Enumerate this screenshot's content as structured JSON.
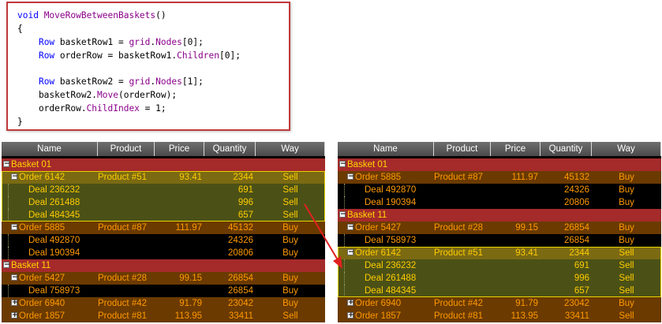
{
  "code": {
    "lines": [
      [
        {
          "t": "void ",
          "c": "kw"
        },
        {
          "t": "MoveRowBetweenBaskets",
          "c": "mt"
        },
        {
          "t": "()",
          "c": ""
        }
      ],
      [
        {
          "t": "{",
          "c": ""
        }
      ],
      [
        {
          "t": "    ",
          "c": ""
        },
        {
          "t": "Row",
          "c": "kw"
        },
        {
          "t": " basketRow1 = ",
          "c": ""
        },
        {
          "t": "grid",
          "c": "mt"
        },
        {
          "t": ".",
          "c": ""
        },
        {
          "t": "Nodes",
          "c": "mt"
        },
        {
          "t": "[0];",
          "c": ""
        }
      ],
      [
        {
          "t": "    ",
          "c": ""
        },
        {
          "t": "Row",
          "c": "kw"
        },
        {
          "t": " orderRow = basketRow1.",
          "c": ""
        },
        {
          "t": "Children",
          "c": "mt"
        },
        {
          "t": "[0];",
          "c": ""
        }
      ],
      [
        {
          "t": "",
          "c": ""
        }
      ],
      [
        {
          "t": "    ",
          "c": ""
        },
        {
          "t": "Row",
          "c": "kw"
        },
        {
          "t": " basketRow2 = ",
          "c": ""
        },
        {
          "t": "grid",
          "c": "mt"
        },
        {
          "t": ".",
          "c": ""
        },
        {
          "t": "Nodes",
          "c": "mt"
        },
        {
          "t": "[1];",
          "c": ""
        }
      ],
      [
        {
          "t": "    basketRow2.",
          "c": ""
        },
        {
          "t": "Move",
          "c": "mt"
        },
        {
          "t": "(orderRow);",
          "c": ""
        }
      ],
      [
        {
          "t": "    orderRow.",
          "c": ""
        },
        {
          "t": "ChildIndex",
          "c": "mt"
        },
        {
          "t": " = 1;",
          "c": ""
        }
      ],
      [
        {
          "t": "}",
          "c": ""
        }
      ]
    ]
  },
  "columns": [
    "Name",
    "Product",
    "Price",
    "Quantity",
    "Way"
  ],
  "grid_left": [
    {
      "kind": "basket",
      "name": "Basket 01",
      "exp": "minus"
    },
    {
      "kind": "order",
      "sel": true,
      "name": "Order 6142",
      "product": "Product #51",
      "price": "93.41",
      "qty": "2344",
      "way": "Sell",
      "exp": "minus"
    },
    {
      "kind": "deal",
      "sel": true,
      "name": "Deal 236232",
      "qty": "691",
      "way": "Sell"
    },
    {
      "kind": "deal",
      "sel": true,
      "name": "Deal 261488",
      "qty": "996",
      "way": "Sell"
    },
    {
      "kind": "deal",
      "sel": true,
      "name": "Deal 484345",
      "qty": "657",
      "way": "Sell"
    },
    {
      "kind": "order",
      "name": "Order 5885",
      "product": "Product #87",
      "price": "111.97",
      "qty": "45132",
      "way": "Buy",
      "exp": "minus"
    },
    {
      "kind": "deal",
      "name": "Deal 492870",
      "qty": "24326",
      "way": "Buy"
    },
    {
      "kind": "deal",
      "name": "Deal 190394",
      "qty": "20806",
      "way": "Buy"
    },
    {
      "kind": "basket",
      "name": "Basket 11",
      "exp": "minus"
    },
    {
      "kind": "order",
      "name": "Order 5427",
      "product": "Product #28",
      "price": "99.15",
      "qty": "26854",
      "way": "Buy",
      "exp": "minus"
    },
    {
      "kind": "deal",
      "name": "Deal 758973",
      "qty": "26854",
      "way": "Buy"
    },
    {
      "kind": "order",
      "name": "Order 6940",
      "product": "Product #42",
      "price": "91.79",
      "qty": "23042",
      "way": "Buy",
      "exp": "plus"
    },
    {
      "kind": "order",
      "name": "Order 1857",
      "product": "Product #81",
      "price": "113.95",
      "qty": "33411",
      "way": "Sell",
      "exp": "plus"
    }
  ],
  "grid_right": [
    {
      "kind": "basket",
      "name": "Basket 01",
      "exp": "minus"
    },
    {
      "kind": "order",
      "name": "Order 5885",
      "product": "Product #87",
      "price": "111.97",
      "qty": "45132",
      "way": "Buy",
      "exp": "minus"
    },
    {
      "kind": "deal",
      "name": "Deal 492870",
      "qty": "24326",
      "way": "Buy"
    },
    {
      "kind": "deal",
      "name": "Deal 190394",
      "qty": "20806",
      "way": "Buy"
    },
    {
      "kind": "basket",
      "name": "Basket 11",
      "exp": "minus"
    },
    {
      "kind": "order",
      "name": "Order 5427",
      "product": "Product #28",
      "price": "99.15",
      "qty": "26854",
      "way": "Buy",
      "exp": "minus"
    },
    {
      "kind": "deal",
      "name": "Deal 758973",
      "qty": "26854",
      "way": "Buy"
    },
    {
      "kind": "order",
      "sel": true,
      "name": "Order 6142",
      "product": "Product #51",
      "price": "93.41",
      "qty": "2344",
      "way": "Sell",
      "exp": "minus"
    },
    {
      "kind": "deal",
      "sel": true,
      "name": "Deal 236232",
      "qty": "691",
      "way": "Sell"
    },
    {
      "kind": "deal",
      "sel": true,
      "name": "Deal 261488",
      "qty": "996",
      "way": "Sell"
    },
    {
      "kind": "deal",
      "sel": true,
      "name": "Deal 484345",
      "qty": "657",
      "way": "Sell"
    },
    {
      "kind": "order",
      "name": "Order 6940",
      "product": "Product #42",
      "price": "91.79",
      "qty": "23042",
      "way": "Buy",
      "exp": "plus"
    },
    {
      "kind": "order",
      "name": "Order 1857",
      "product": "Product #81",
      "price": "113.95",
      "qty": "33411",
      "way": "Sell",
      "exp": "plus"
    }
  ],
  "colors": {
    "basket": "#a52a2a",
    "order": "#6b3a00",
    "selected_order": "#7b6a12",
    "selected_deal": "#4b5116",
    "text_orange": "#ff9900",
    "text_yellow": "#ffd700",
    "arrow": "#e02020"
  },
  "icons": {
    "expand": "plus-box-icon",
    "collapse": "minus-box-icon"
  }
}
